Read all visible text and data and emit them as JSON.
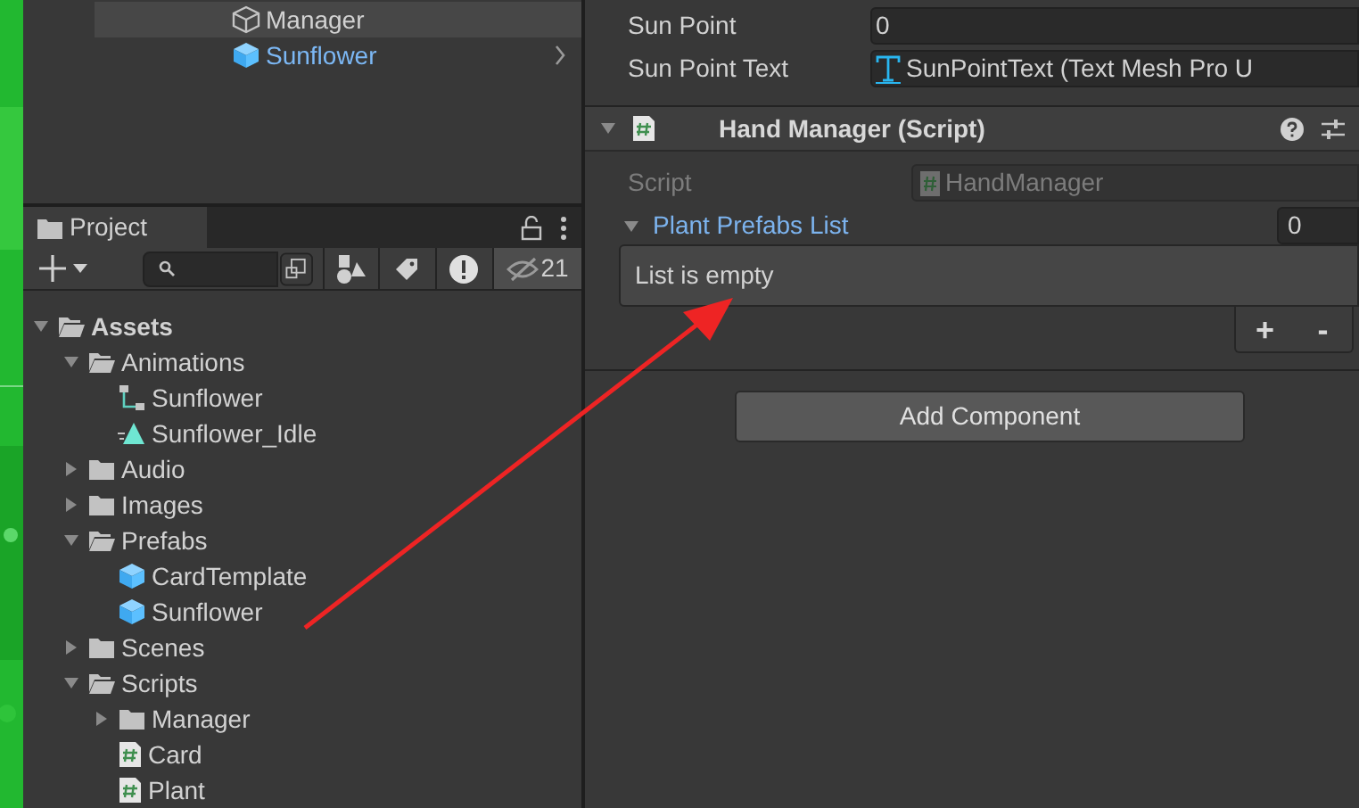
{
  "hierarchy": {
    "items": [
      {
        "name": "Manager",
        "kind": "object",
        "selected": true
      },
      {
        "name": "Sunflower",
        "kind": "prefab",
        "selected": false,
        "has_children": true
      }
    ]
  },
  "project": {
    "tab": "Project",
    "hidden_count": "21",
    "tree": [
      {
        "name": "Assets",
        "kind": "folder",
        "expanded": true,
        "children": [
          {
            "name": "Animations",
            "kind": "folder",
            "expanded": true,
            "children": [
              {
                "name": "Sunflower",
                "kind": "controller"
              },
              {
                "name": "Sunflower_Idle",
                "kind": "clip"
              }
            ]
          },
          {
            "name": "Audio",
            "kind": "folder",
            "expanded": false
          },
          {
            "name": "Images",
            "kind": "folder",
            "expanded": false
          },
          {
            "name": "Prefabs",
            "kind": "folder",
            "expanded": true,
            "children": [
              {
                "name": "CardTemplate",
                "kind": "prefab"
              },
              {
                "name": "Sunflower",
                "kind": "prefab"
              }
            ]
          },
          {
            "name": "Scenes",
            "kind": "folder",
            "expanded": false
          },
          {
            "name": "Scripts",
            "kind": "folder",
            "expanded": true,
            "children": [
              {
                "name": "Manager",
                "kind": "folder",
                "expanded": false
              },
              {
                "name": "Card",
                "kind": "script"
              },
              {
                "name": "Plant",
                "kind": "script"
              }
            ]
          }
        ]
      }
    ]
  },
  "inspector": {
    "fields": [
      {
        "label": "Sun Point",
        "value": "0",
        "kind": "number"
      },
      {
        "label": "Sun Point Text",
        "value": "SunPointText (Text Mesh Pro U",
        "kind": "object"
      }
    ],
    "component": {
      "title": "Hand Manager (Script)",
      "expanded": true,
      "script_label": "Script",
      "script_value": "HandManager",
      "list": {
        "label": "Plant Prefabs List",
        "size": "0",
        "expanded": true,
        "empty_text": "List is empty",
        "add": "+",
        "remove": "-"
      }
    },
    "add_component": "Add Component"
  }
}
